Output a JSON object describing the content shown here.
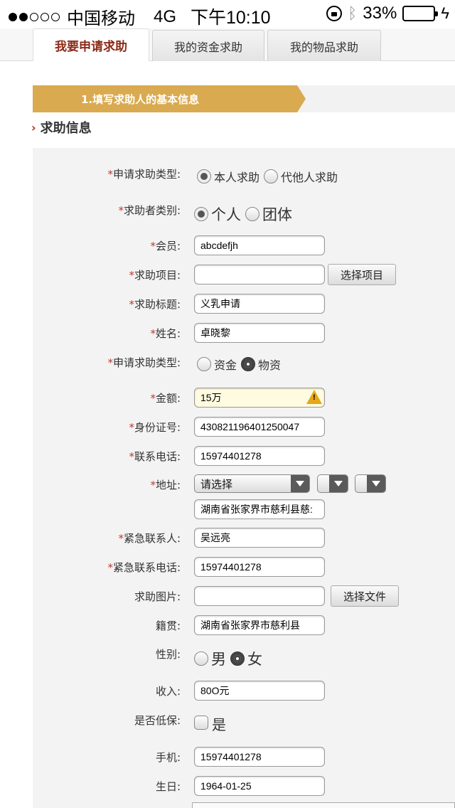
{
  "status_bar": {
    "carrier": "中国移动",
    "network": "4G",
    "time": "下午10:10",
    "battery": "33%",
    "battery_level": 0.33
  },
  "tabs": [
    {
      "label": "我要申请求助",
      "active": true
    },
    {
      "label": "我的资金求助",
      "active": false
    },
    {
      "label": "我的物品求助",
      "active": false
    }
  ],
  "step": {
    "label": "1.填写求助人的基本信息"
  },
  "section": {
    "title": "求助信息"
  },
  "form": {
    "apply_type": {
      "label": "申请求助类型:",
      "options": [
        "本人求助",
        "代他人求助"
      ],
      "selected": "本人求助"
    },
    "seeker_type": {
      "label": "求助者类别:",
      "options": [
        "个人",
        "团体"
      ],
      "selected": "个人"
    },
    "member": {
      "label": "会员:",
      "value": "abcdefjh"
    },
    "project": {
      "label": "求助项目:",
      "value": "",
      "button": "选择项目"
    },
    "title": {
      "label": "求助标题:",
      "value": "义乳申请"
    },
    "name": {
      "label": "姓名:",
      "value": "卓晓黎"
    },
    "aid_type": {
      "label": "申请求助类型:",
      "options": [
        "资金",
        "物资"
      ],
      "selected": "物资"
    },
    "amount": {
      "label": "金额:",
      "value": "15万"
    },
    "id_number": {
      "label": "身份证号:",
      "value": "430821196401250047"
    },
    "phone": {
      "label": "联系电话:",
      "value": "15974401278"
    },
    "address": {
      "label": "地址:",
      "select_value": "请选择",
      "value": "湖南省张家界市慈利县慈:"
    },
    "emergency_contact": {
      "label": "紧急联系人:",
      "value": "吴远亮"
    },
    "emergency_phone": {
      "label": "紧急联系电话:",
      "value": "15974401278"
    },
    "image": {
      "label": "求助图片:",
      "value": "",
      "button": "选择文件"
    },
    "native_place": {
      "label": "籍贯:",
      "value": "湖南省张家界市慈利县"
    },
    "gender": {
      "label": "性别:",
      "options": [
        "男",
        "女"
      ],
      "selected": "女"
    },
    "income": {
      "label": "收入:",
      "value": "80O元"
    },
    "low_income": {
      "label": "是否低保:",
      "option": "是",
      "checked": false
    },
    "mobile": {
      "label": "手机:",
      "value": "15974401278"
    },
    "birthday": {
      "label": "生日:",
      "value": "1964-01-25"
    }
  }
}
